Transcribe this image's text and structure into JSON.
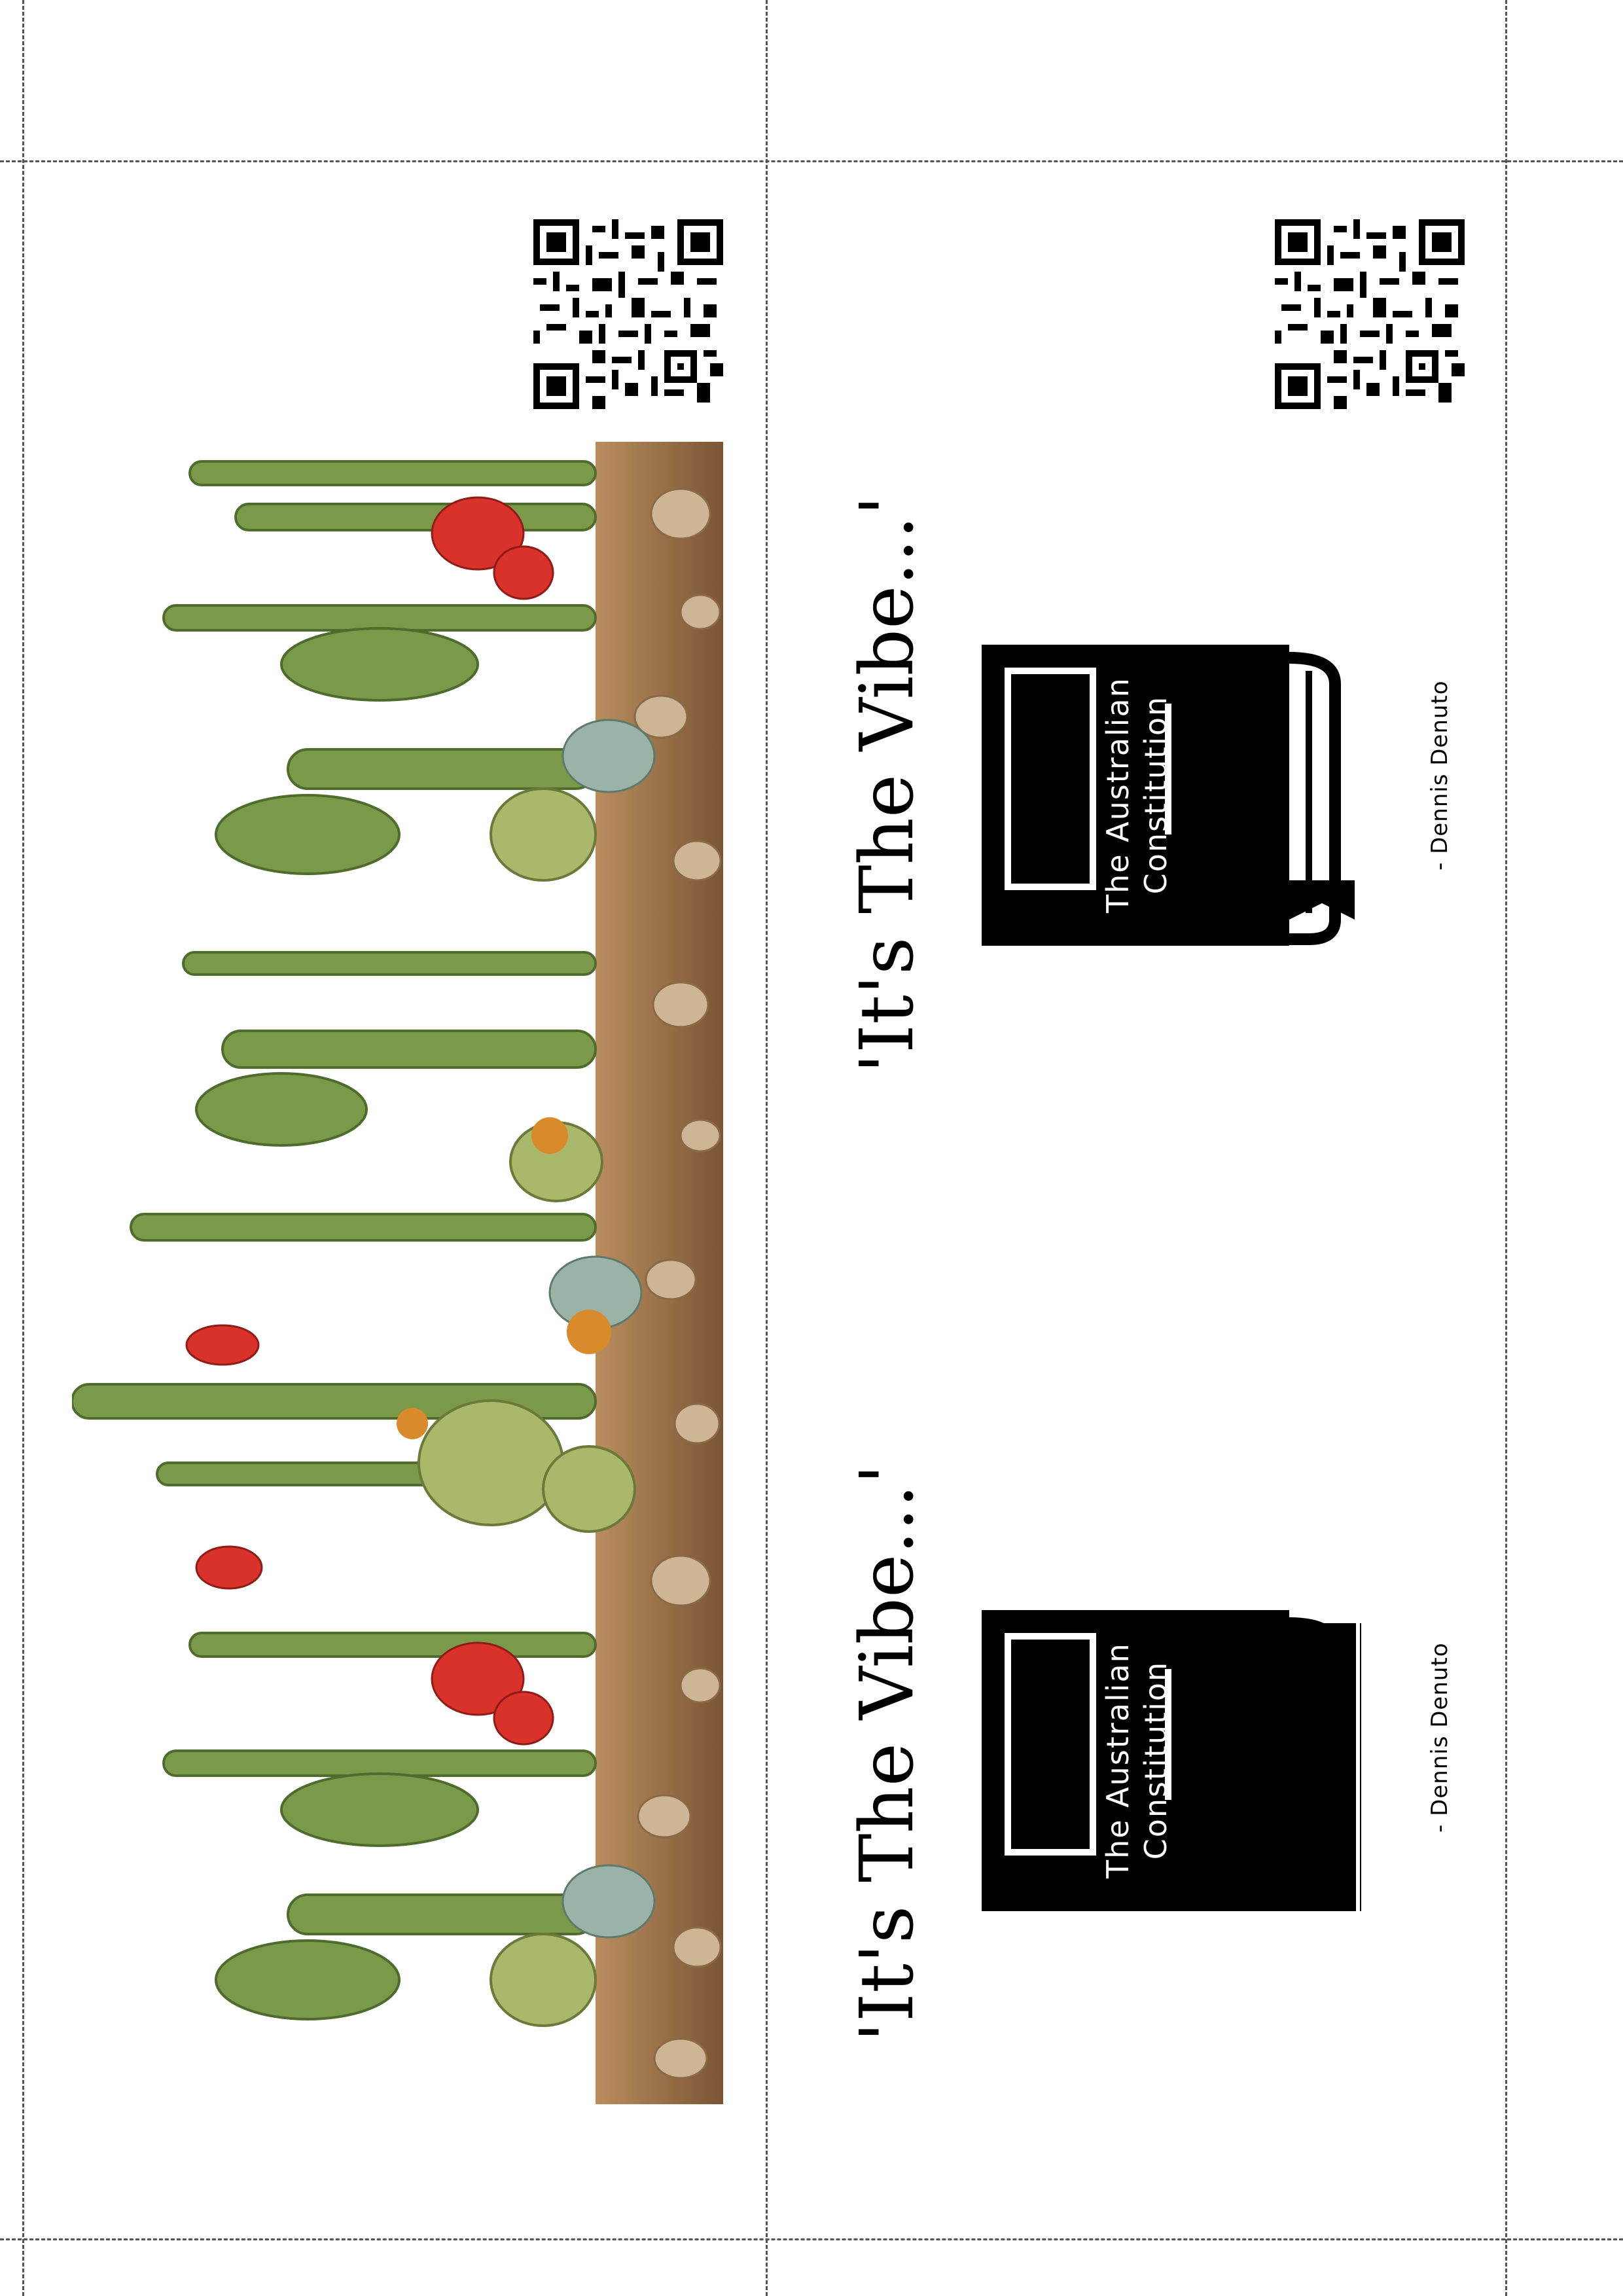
{
  "quote_text": "'It's The Vibe...'",
  "book": {
    "line1": "The Australian",
    "line2": "Constitution"
  },
  "attribution": "- Dennis Denuto",
  "colors": {
    "ink": "#000000",
    "cutline": "#555555",
    "cactus_green": "#7a9a4a",
    "flower_red": "#d9322a",
    "soil": "#8a6a45"
  },
  "icons": [
    "qr-code-icon",
    "book-icon",
    "bookmark-icon",
    "cactus-illustration"
  ]
}
